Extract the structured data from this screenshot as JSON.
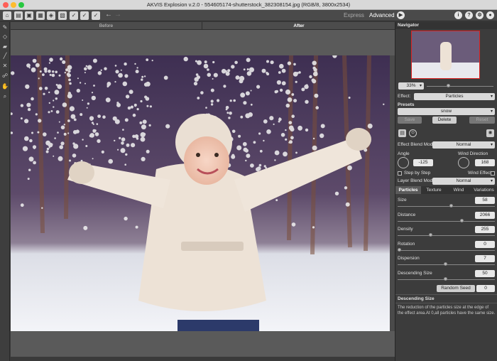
{
  "window": {
    "title": "AKVIS Explosion v.2.0 - 554605174-shutterstock_382308154.jpg (RGB/8, 3800x2534)"
  },
  "toolbar": {
    "mode_express": "Express",
    "mode_advanced": "Advanced"
  },
  "view_tabs": {
    "before": "Before",
    "after": "After"
  },
  "navigator": {
    "title": "Navigator",
    "zoom": "33%"
  },
  "effect": {
    "label": "Effect:",
    "value": "Particles"
  },
  "presets": {
    "label": "Presets",
    "value": "snow",
    "save": "Save",
    "delete": "Delete",
    "reset": "Reset"
  },
  "blend": {
    "effect_label": "Effect Blend Mode",
    "effect_value": "Normal",
    "layer_label": "Layer Blend Mode",
    "layer_value": "Normal"
  },
  "angle": {
    "label": "Angle",
    "value": "-125"
  },
  "wind": {
    "label": "Wind Direction",
    "value": "168",
    "effect_label": "Wind Effect"
  },
  "step": {
    "label": "Step by Step"
  },
  "tabs": [
    "Particles",
    "Texture",
    "Wind",
    "Variations"
  ],
  "params": [
    {
      "label": "Size",
      "value": "58",
      "level": 0.56
    },
    {
      "label": "Distance",
      "value": "2066",
      "level": 0.68
    },
    {
      "label": "Density",
      "value": "255",
      "level": 0.34
    },
    {
      "label": "Rotation",
      "value": "0",
      "level": 0.0
    },
    {
      "label": "Dispersion",
      "value": "7",
      "level": 0.5
    },
    {
      "label": "Descending Size",
      "value": "50",
      "level": 0.5
    }
  ],
  "random_seed": {
    "label": "Random Seed",
    "value": "0"
  },
  "hint": {
    "title": "Descending Size",
    "text": "The reduction of the particles size at the edge of the effect area.At 0,all particles have the same size."
  },
  "colors": {
    "accent": "#5a5a5a",
    "panel": "#3c3c3c"
  }
}
